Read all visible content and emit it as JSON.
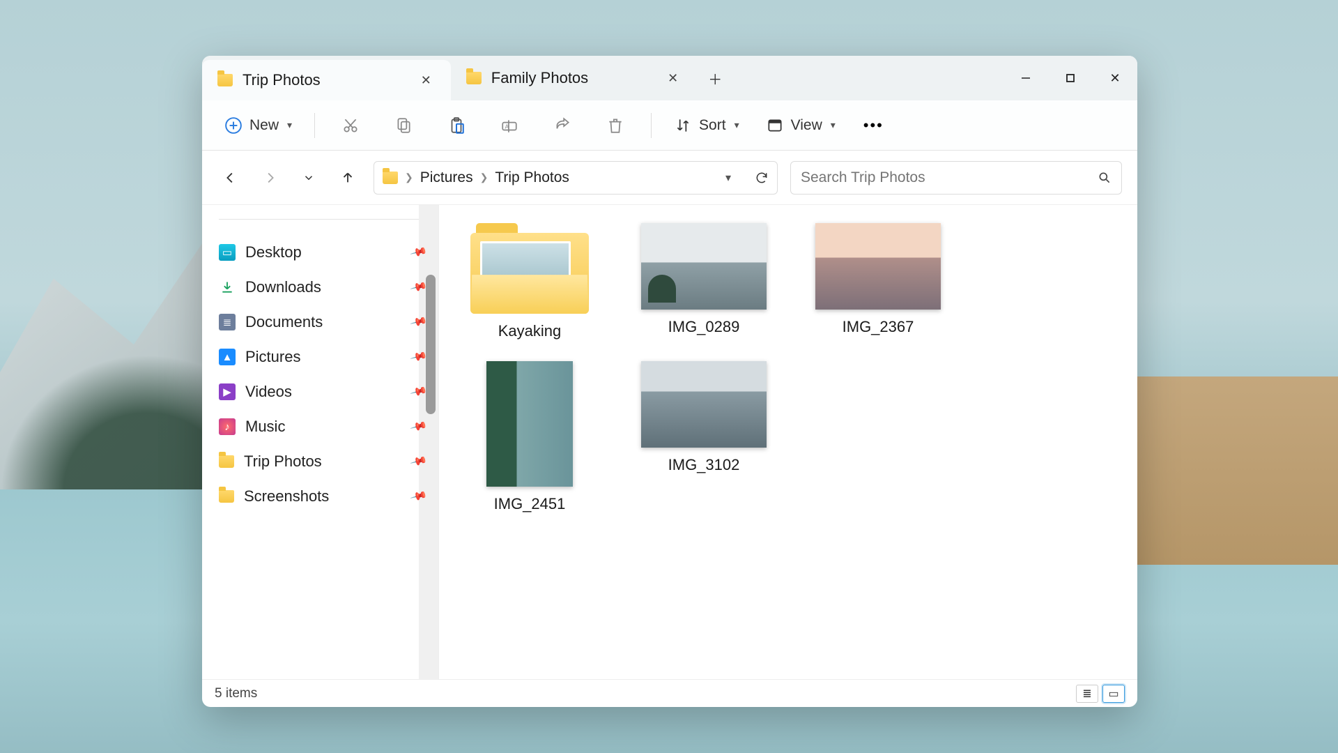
{
  "tabs": [
    {
      "title": "Trip Photos",
      "active": true
    },
    {
      "title": "Family Photos",
      "active": false
    }
  ],
  "toolbar": {
    "new": "New",
    "sort": "Sort",
    "view": "View"
  },
  "breadcrumb": [
    "Pictures",
    "Trip Photos"
  ],
  "search": {
    "placeholder": "Search Trip Photos"
  },
  "sidebar": {
    "items": [
      {
        "label": "Desktop",
        "icon": "desktop"
      },
      {
        "label": "Downloads",
        "icon": "downloads"
      },
      {
        "label": "Documents",
        "icon": "documents"
      },
      {
        "label": "Pictures",
        "icon": "pictures"
      },
      {
        "label": "Videos",
        "icon": "videos"
      },
      {
        "label": "Music",
        "icon": "music"
      },
      {
        "label": "Trip Photos",
        "icon": "folder"
      },
      {
        "label": "Screenshots",
        "icon": "folder"
      }
    ]
  },
  "items": [
    {
      "name": "Kayaking",
      "type": "folder"
    },
    {
      "name": "IMG_0289",
      "type": "image",
      "thumb": "th1"
    },
    {
      "name": "IMG_2367",
      "type": "image",
      "thumb": "th2"
    },
    {
      "name": "IMG_2451",
      "type": "image",
      "thumb": "th3"
    },
    {
      "name": "IMG_3102",
      "type": "image",
      "thumb": "th4"
    }
  ],
  "status": {
    "text": "5 items"
  }
}
